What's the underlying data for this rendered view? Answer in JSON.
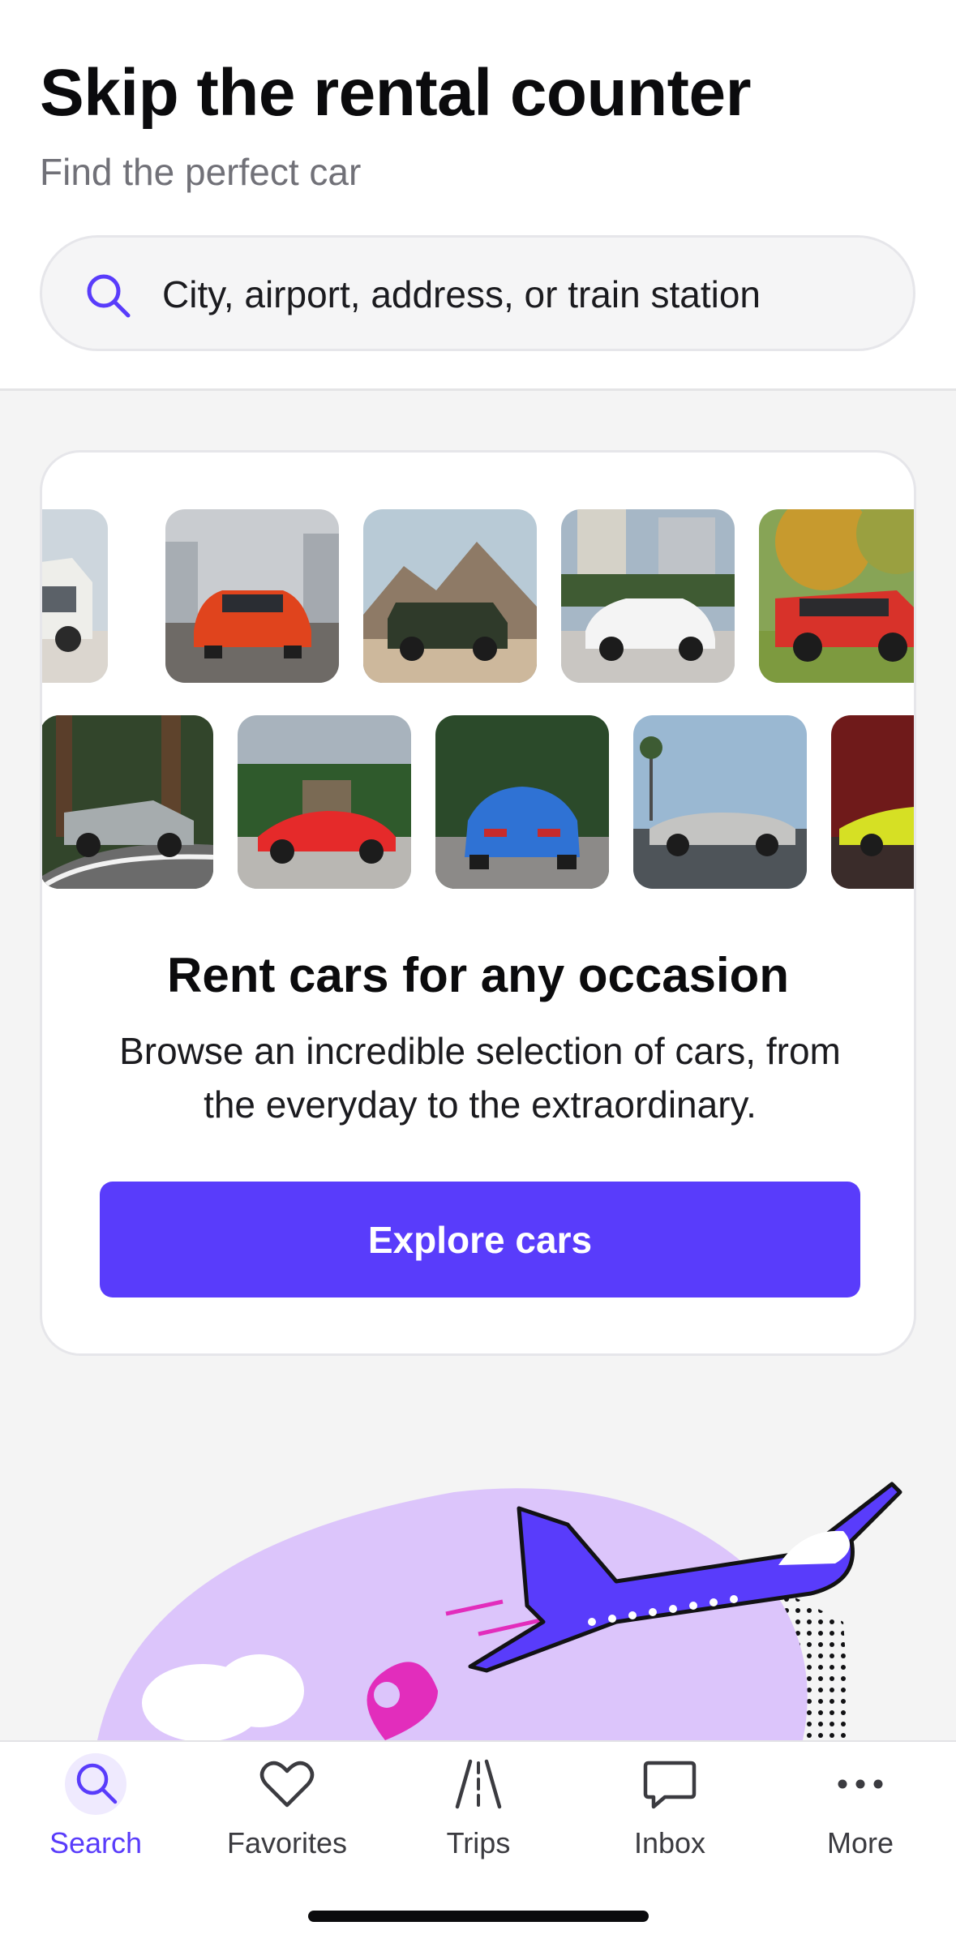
{
  "header": {
    "title": "Skip the rental counter",
    "subtitle": "Find the perfect car",
    "search_placeholder": "City, airport, address, or train station"
  },
  "promo_card": {
    "title": "Rent cars for any occasion",
    "description": "Browse an incredible selection of cars, from the everyday to the extraordinary.",
    "cta_label": "Explore cars",
    "cta_color": "#593cfb",
    "car_images_row1": [
      "white-camper-van",
      "orange-bmw-coupe",
      "dark-green-jeep",
      "white-hatchback",
      "red-range-rover"
    ],
    "car_images_row2": [
      "silver-electric-pickup",
      "red-mazda-roadster",
      "blue-mustang",
      "silver-classic-convertible",
      "yellow-corvette"
    ]
  },
  "tab_bar": {
    "active_color": "#593cfb",
    "items": [
      {
        "label": "Search",
        "icon": "search-icon",
        "active": true
      },
      {
        "label": "Favorites",
        "icon": "heart-icon",
        "active": false
      },
      {
        "label": "Trips",
        "icon": "road-icon",
        "active": false
      },
      {
        "label": "Inbox",
        "icon": "chat-bubble-icon",
        "active": false
      },
      {
        "label": "More",
        "icon": "more-dots-icon",
        "active": false
      }
    ]
  }
}
